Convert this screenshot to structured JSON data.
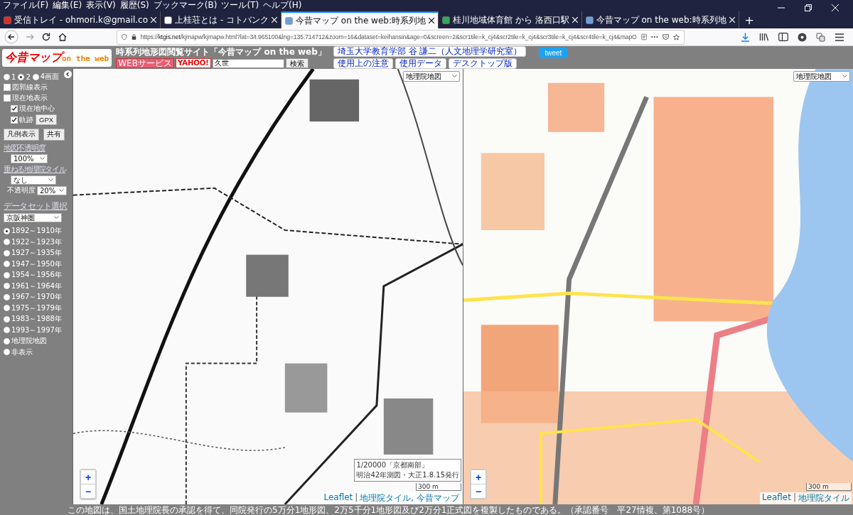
{
  "browser": {
    "menu": [
      "ファイル(F)",
      "編集(E)",
      "表示(V)",
      "履歴(S)",
      "ブックマーク(B)",
      "ツール(T)",
      "ヘルプ(H)"
    ],
    "tabs": [
      {
        "title": "受信トレイ - ohmori.k@gmail.co",
        "selected": false
      },
      {
        "title": "上桂荘とは - コトバンク",
        "selected": false
      },
      {
        "title": "今昔マップ on the web:時系列地",
        "selected": true
      },
      {
        "title": "桂川地域体育館 から 洛西口駅",
        "selected": false
      },
      {
        "title": "今昔マップ on the web:時系列地",
        "selected": false
      }
    ],
    "new_tab": "+",
    "url": "https://**ktgis.net**/kjmapw/kjmapw.html?lat=34.965100&lng=135.714712&zoom=16&dataset=keihansin&age=0&screen=2&scr1tile=k_cj4&scr2tile=k_cj4&scr3tile=k_cj4&scr4tile=k_cj4&mapO"
  },
  "site": {
    "logo": {
      "main": "今昔マップ",
      "sub": "on the web"
    },
    "title": "時系列地形図閲覧サイト「今昔マップ on the web」",
    "search": {
      "badge_service": "WEBサービス",
      "badge_brand": "YAHOO!",
      "value": "久世",
      "button": "検索"
    },
    "links": [
      {
        "text": "埼玉大学教育学部 谷 謙二（人文地理学研究室）"
      },
      {
        "text": "使用上の注意"
      },
      {
        "text": "使用データ"
      },
      {
        "text": "デスクトップ版"
      }
    ],
    "tweet": "tweet"
  },
  "sidebar": {
    "screens": [
      {
        "label": "1",
        "selected": false
      },
      {
        "label": "2",
        "selected": true
      },
      {
        "label": "4画面",
        "selected": false
      }
    ],
    "options": [
      {
        "label": "図郭線表示",
        "checked": false
      },
      {
        "label": "現在地表示",
        "checked": false,
        "children": [
          {
            "label": "現在地中心",
            "checked": true
          },
          {
            "label": "軌跡",
            "checked": true,
            "button": "GPX"
          }
        ]
      }
    ],
    "buttons": [
      "凡例表示",
      "共有"
    ],
    "opacity": {
      "label": "地図不透明度",
      "value": "100%"
    },
    "overlay": {
      "label": "重ねる地理院タイル",
      "value": "なし",
      "opacity_label": "不透明度",
      "opacity_value": "20%"
    },
    "dataset": {
      "label": "データセット選択",
      "value": "京阪神圏"
    },
    "periods": [
      {
        "label": "1892～1910年",
        "selected": true
      },
      {
        "label": "1922～1923年",
        "selected": false
      },
      {
        "label": "1927～1935年",
        "selected": false
      },
      {
        "label": "1947～1950年",
        "selected": false
      },
      {
        "label": "1954～1956年",
        "selected": false
      },
      {
        "label": "1961～1964年",
        "selected": false
      },
      {
        "label": "1967～1970年",
        "selected": false
      },
      {
        "label": "1975～1979年",
        "selected": false
      },
      {
        "label": "1983～1988年",
        "selected": false
      },
      {
        "label": "1993～1997年",
        "selected": false
      },
      {
        "label": "地理院地図",
        "selected": false
      },
      {
        "label": "非表示",
        "selected": false
      }
    ]
  },
  "maps": [
    {
      "kind": "old",
      "layer": "地理院地図",
      "info": [
        "1/20000「京都南部」",
        "明治42年測図・大正1.8.15発行"
      ],
      "zoom": [
        "+",
        "−"
      ],
      "scale": "300 m",
      "attribution": {
        "links": [
          "Leaflet",
          "地理院タイル, 今昔マップ"
        ],
        "separator": "|"
      }
    },
    {
      "kind": "modern",
      "layer": "地理院地図",
      "zoom": [
        "+",
        "−"
      ],
      "scale": "300 m",
      "attribution": {
        "links": [
          "Leaflet",
          "地理院タイル"
        ],
        "separator": "|"
      }
    }
  ],
  "footer": "この地図は、国土地理院長の承認を得て、同院発行の5万分1地形図、2万5千分1地形図及び2万分1正式図を複製したものである。（承認番号　平27情複、第1088号）"
}
